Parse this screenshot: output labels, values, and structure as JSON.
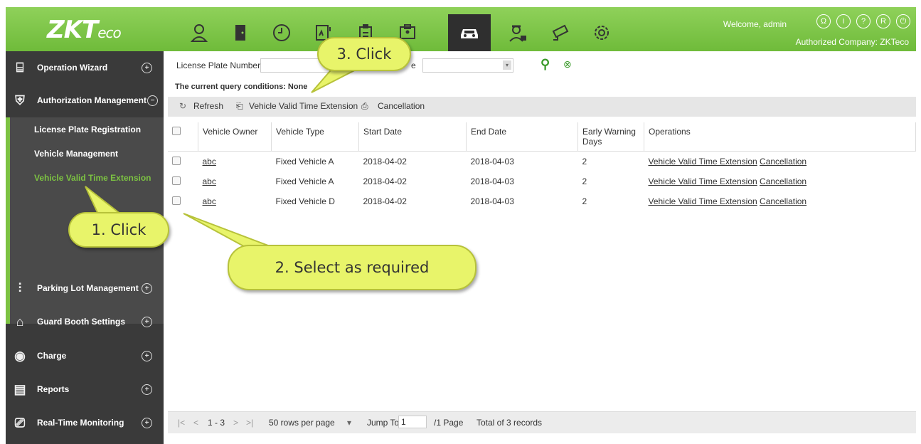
{
  "header": {
    "logo": "ZKT",
    "logo_suffix": "eco",
    "welcome": "Welcome, admin",
    "company": "Authorized Company: ZKTeco",
    "nav_icons": [
      "person-icon",
      "door-icon",
      "clock-icon",
      "elevator-icon",
      "building-icon",
      "id-card-icon",
      "car-icon",
      "guard-icon",
      "camera-icon",
      "gear-icon"
    ]
  },
  "sidebar": {
    "top_items": [
      {
        "label": "Operation Wizard",
        "icon": "wizard-icon"
      },
      {
        "label": "Authorization Management",
        "icon": "shield-icon"
      }
    ],
    "sub_items": [
      "License Plate Registration",
      "Vehicle Management",
      "Vehicle Valid Time Extension"
    ],
    "bottom_items": [
      {
        "label": "Parking Lot Management",
        "icon": "sliders-icon"
      },
      {
        "label": "Guard Booth Settings",
        "icon": "booth-icon"
      },
      {
        "label": "Charge",
        "icon": "charge-icon"
      },
      {
        "label": "Reports",
        "icon": "report-icon"
      },
      {
        "label": "Real-Time Monitoring",
        "icon": "camera-icon"
      }
    ]
  },
  "search": {
    "plate_label": "License Plate Number",
    "type_label_suffix": "e",
    "query_conditions": "The current query conditions: None"
  },
  "toolbar": {
    "refresh": "Refresh",
    "extend": "Vehicle Valid Time Extension",
    "cancel": "Cancellation"
  },
  "table": {
    "headers": [
      "Vehicle Owner",
      "Vehicle Type",
      "Start Date",
      "End Date",
      "Early Warning Days",
      "Operations"
    ],
    "rows": [
      {
        "owner": "abc",
        "type": "Fixed Vehicle A",
        "start": "2018-04-02",
        "end": "2018-04-03",
        "warn": "2",
        "op1": "Vehicle Valid Time Extension",
        "op2": "Cancellation"
      },
      {
        "owner": "abc",
        "type": "Fixed Vehicle A",
        "start": "2018-04-02",
        "end": "2018-04-03",
        "warn": "2",
        "op1": "Vehicle Valid Time Extension",
        "op2": "Cancellation"
      },
      {
        "owner": "abc",
        "type": "Fixed Vehicle D",
        "start": "2018-04-02",
        "end": "2018-04-03",
        "warn": "2",
        "op1": "Vehicle Valid Time Extension",
        "op2": "Cancellation"
      }
    ]
  },
  "pager": {
    "range": "1 - 3",
    "rows_per_page": "50 rows per page",
    "jump_to": "Jump To",
    "jump_value": "1",
    "pages": "/1 Page",
    "total": "Total of 3 records"
  },
  "callouts": {
    "one": "1. Click",
    "two": "2. Select as required",
    "three": "3. Click"
  }
}
